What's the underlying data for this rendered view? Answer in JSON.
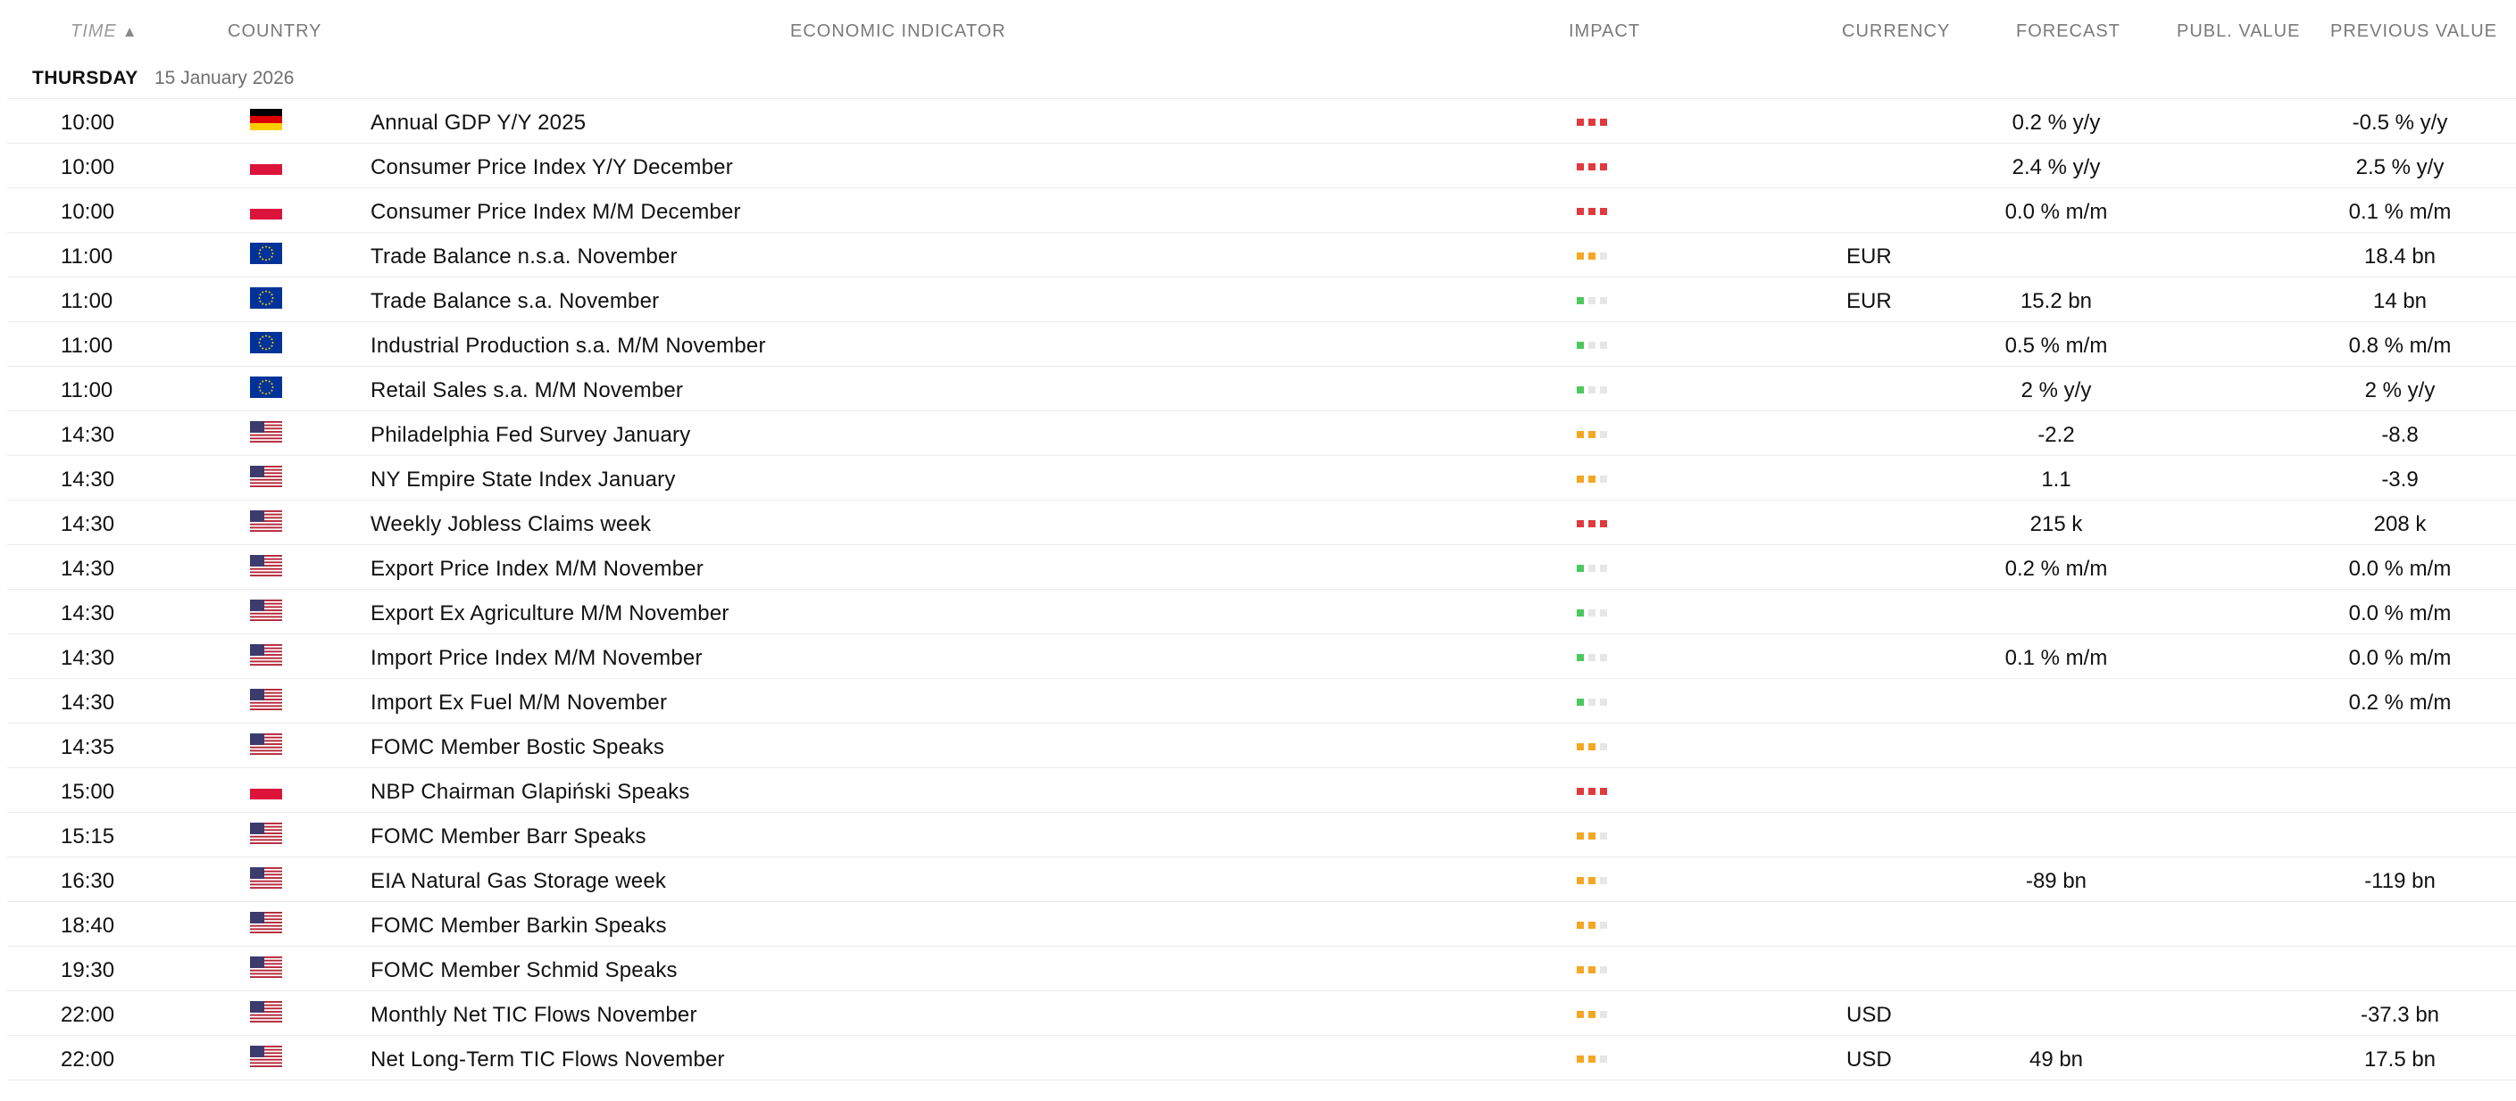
{
  "colors": {
    "impact_high": "#e0393e",
    "impact_medium": "#f5a623",
    "impact_low": "#4cc95d",
    "impact_off": "#e6e6e6"
  },
  "header": {
    "time": "TIME",
    "country": "COUNTRY",
    "indicator": "ECONOMIC INDICATOR",
    "impact": "IMPACT",
    "currency": "CURRENCY",
    "forecast": "FORECAST",
    "publ_value": "PUBL. VALUE",
    "previous_value": "PREVIOUS VALUE",
    "sort_icon": "sort-ascending-icon"
  },
  "day": {
    "name": "THURSDAY",
    "date": "15 January 2026"
  },
  "rows": [
    {
      "time": "10:00",
      "country": "germany",
      "indicator": "Annual GDP Y/Y 2025",
      "impact": "high",
      "currency": "",
      "forecast": "0.2 % y/y",
      "publ_value": "",
      "previous": "-0.5 % y/y"
    },
    {
      "time": "10:00",
      "country": "poland",
      "indicator": "Consumer Price Index Y/Y December",
      "impact": "high",
      "currency": "",
      "forecast": "2.4 % y/y",
      "publ_value": "",
      "previous": "2.5 % y/y"
    },
    {
      "time": "10:00",
      "country": "poland",
      "indicator": "Consumer Price Index M/M December",
      "impact": "high",
      "currency": "",
      "forecast": "0.0 % m/m",
      "publ_value": "",
      "previous": "0.1 % m/m"
    },
    {
      "time": "11:00",
      "country": "eu",
      "indicator": "Trade Balance n.s.a. November",
      "impact": "medium",
      "currency": "EUR",
      "forecast": "",
      "publ_value": "",
      "previous": "18.4 bn"
    },
    {
      "time": "11:00",
      "country": "eu",
      "indicator": "Trade Balance s.a. November",
      "impact": "low",
      "currency": "EUR",
      "forecast": "15.2 bn",
      "publ_value": "",
      "previous": "14 bn"
    },
    {
      "time": "11:00",
      "country": "eu",
      "indicator": "Industrial Production s.a. M/M November",
      "impact": "low",
      "currency": "",
      "forecast": "0.5 % m/m",
      "publ_value": "",
      "previous": "0.8 % m/m"
    },
    {
      "time": "11:00",
      "country": "eu",
      "indicator": "Retail Sales s.a. M/M November",
      "impact": "low",
      "currency": "",
      "forecast": "2 % y/y",
      "publ_value": "",
      "previous": "2 % y/y"
    },
    {
      "time": "14:30",
      "country": "usa",
      "indicator": "Philadelphia Fed Survey January",
      "impact": "medium",
      "currency": "",
      "forecast": "-2.2",
      "publ_value": "",
      "previous": "-8.8"
    },
    {
      "time": "14:30",
      "country": "usa",
      "indicator": "NY Empire State Index January",
      "impact": "medium",
      "currency": "",
      "forecast": "1.1",
      "publ_value": "",
      "previous": "-3.9"
    },
    {
      "time": "14:30",
      "country": "usa",
      "indicator": "Weekly Jobless Claims week",
      "impact": "high",
      "currency": "",
      "forecast": "215 k",
      "publ_value": "",
      "previous": "208 k"
    },
    {
      "time": "14:30",
      "country": "usa",
      "indicator": "Export Price Index M/M November",
      "impact": "low",
      "currency": "",
      "forecast": "0.2 % m/m",
      "publ_value": "",
      "previous": "0.0 % m/m"
    },
    {
      "time": "14:30",
      "country": "usa",
      "indicator": "Export Ex Agriculture M/M November",
      "impact": "low",
      "currency": "",
      "forecast": "",
      "publ_value": "",
      "previous": "0.0 % m/m"
    },
    {
      "time": "14:30",
      "country": "usa",
      "indicator": "Import Price Index M/M November",
      "impact": "low",
      "currency": "",
      "forecast": "0.1 % m/m",
      "publ_value": "",
      "previous": "0.0 % m/m"
    },
    {
      "time": "14:30",
      "country": "usa",
      "indicator": "Import Ex Fuel M/M November",
      "impact": "low",
      "currency": "",
      "forecast": "",
      "publ_value": "",
      "previous": "0.2 % m/m"
    },
    {
      "time": "14:35",
      "country": "usa",
      "indicator": "FOMC Member Bostic Speaks",
      "impact": "medium",
      "currency": "",
      "forecast": "",
      "publ_value": "",
      "previous": ""
    },
    {
      "time": "15:00",
      "country": "poland",
      "indicator": "NBP Chairman Glapiński Speaks",
      "impact": "high",
      "currency": "",
      "forecast": "",
      "publ_value": "",
      "previous": ""
    },
    {
      "time": "15:15",
      "country": "usa",
      "indicator": "FOMC Member Barr Speaks",
      "impact": "medium",
      "currency": "",
      "forecast": "",
      "publ_value": "",
      "previous": ""
    },
    {
      "time": "16:30",
      "country": "usa",
      "indicator": "EIA Natural Gas Storage week",
      "impact": "medium",
      "currency": "",
      "forecast": "-89 bn",
      "publ_value": "",
      "previous": "-119 bn"
    },
    {
      "time": "18:40",
      "country": "usa",
      "indicator": "FOMC Member Barkin Speaks",
      "impact": "medium",
      "currency": "",
      "forecast": "",
      "publ_value": "",
      "previous": ""
    },
    {
      "time": "19:30",
      "country": "usa",
      "indicator": "FOMC Member Schmid Speaks",
      "impact": "medium",
      "currency": "",
      "forecast": "",
      "publ_value": "",
      "previous": ""
    },
    {
      "time": "22:00",
      "country": "usa",
      "indicator": "Monthly Net TIC Flows November",
      "impact": "medium",
      "currency": "USD",
      "forecast": "",
      "publ_value": "",
      "previous": "-37.3 bn"
    },
    {
      "time": "22:00",
      "country": "usa",
      "indicator": "Net Long-Term TIC Flows November",
      "impact": "medium",
      "currency": "USD",
      "forecast": "49 bn",
      "publ_value": "",
      "previous": "17.5 bn"
    }
  ]
}
